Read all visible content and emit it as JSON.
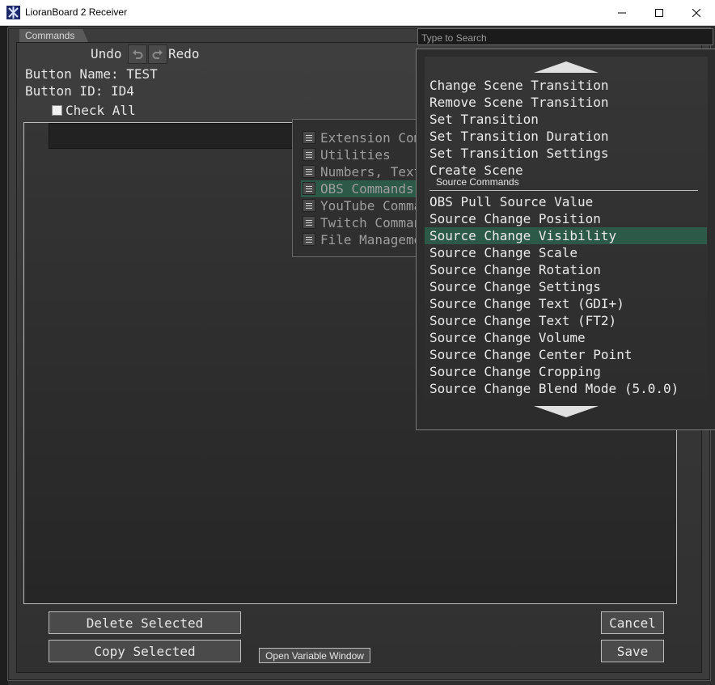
{
  "window": {
    "title": "LioranBoard 2 Receiver",
    "minimize_glyph": "─",
    "maximize_glyph": "☐",
    "close_glyph": "✕"
  },
  "tab": {
    "label": "Commands"
  },
  "toolbar": {
    "undo_label": "Undo",
    "redo_label": "Redo"
  },
  "button_info": {
    "name_line": "Button Name: TEST",
    "id_line": "Button ID: ID4"
  },
  "check_all_label": "Check All",
  "categories": [
    {
      "label": "Extension Commands",
      "selected": false
    },
    {
      "label": "Utilities",
      "selected": false
    },
    {
      "label": "Numbers, Text",
      "selected": false
    },
    {
      "label": "OBS Commands",
      "selected": true
    },
    {
      "label": "YouTube Commands",
      "selected": false
    },
    {
      "label": "Twitch Commands",
      "selected": false
    },
    {
      "label": "File Management",
      "selected": false
    }
  ],
  "search": {
    "placeholder": "Type to Search",
    "value": ""
  },
  "dropdown": {
    "items_top": [
      "Change Scene Transition",
      "Remove Scene Transition",
      "Set Transition",
      "Set Transition Duration",
      "Set Transition Settings",
      "Create Scene"
    ],
    "section_header": "Source Commands",
    "items_bottom": [
      "OBS Pull Source Value",
      "Source Change Position",
      "Source Change Visibility",
      "Source Change Scale",
      "Source Change Rotation",
      "Source Change Settings",
      "Source Change Text (GDI+)",
      "Source Change Text (FT2)",
      "Source Change Volume",
      "Source Change Center Point",
      "Source Change Cropping",
      "Source Change Blend Mode (5.0.0)"
    ],
    "highlighted_item": "Source Change Visibility"
  },
  "buttons": {
    "delete_selected": "Delete Selected",
    "copy_selected": "Copy Selected",
    "open_variable_window": "Open Variable Window",
    "cancel": "Cancel",
    "save": "Save"
  },
  "colors": {
    "selection": "#2d5948",
    "background": "#2e2e2e",
    "text": "#e6e6e6"
  }
}
